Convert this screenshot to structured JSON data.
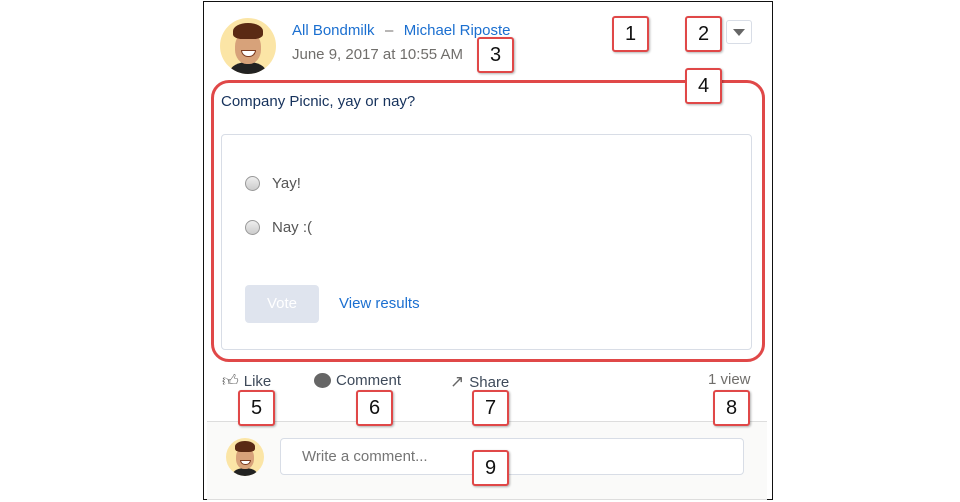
{
  "post": {
    "group": "All Bondmilk",
    "separator": "–",
    "author": "Michael Riposte",
    "timestamp": "June 9, 2017 at 10:55 AM",
    "question": "Company Picnic, yay or nay?",
    "options": [
      "Yay!",
      "Nay :("
    ],
    "vote_label": "Vote",
    "results_label": "View results"
  },
  "actions": {
    "like": "Like",
    "comment": "Comment",
    "share": "Share",
    "views": "1 view"
  },
  "comment_input": {
    "placeholder": "Write a comment..."
  },
  "callouts": [
    "1",
    "2",
    "3",
    "4",
    "5",
    "6",
    "7",
    "8",
    "9"
  ],
  "colors": {
    "link": "#1b6fd0",
    "callout_border": "#e04848",
    "vote_disabled": "#dfe4ee"
  }
}
